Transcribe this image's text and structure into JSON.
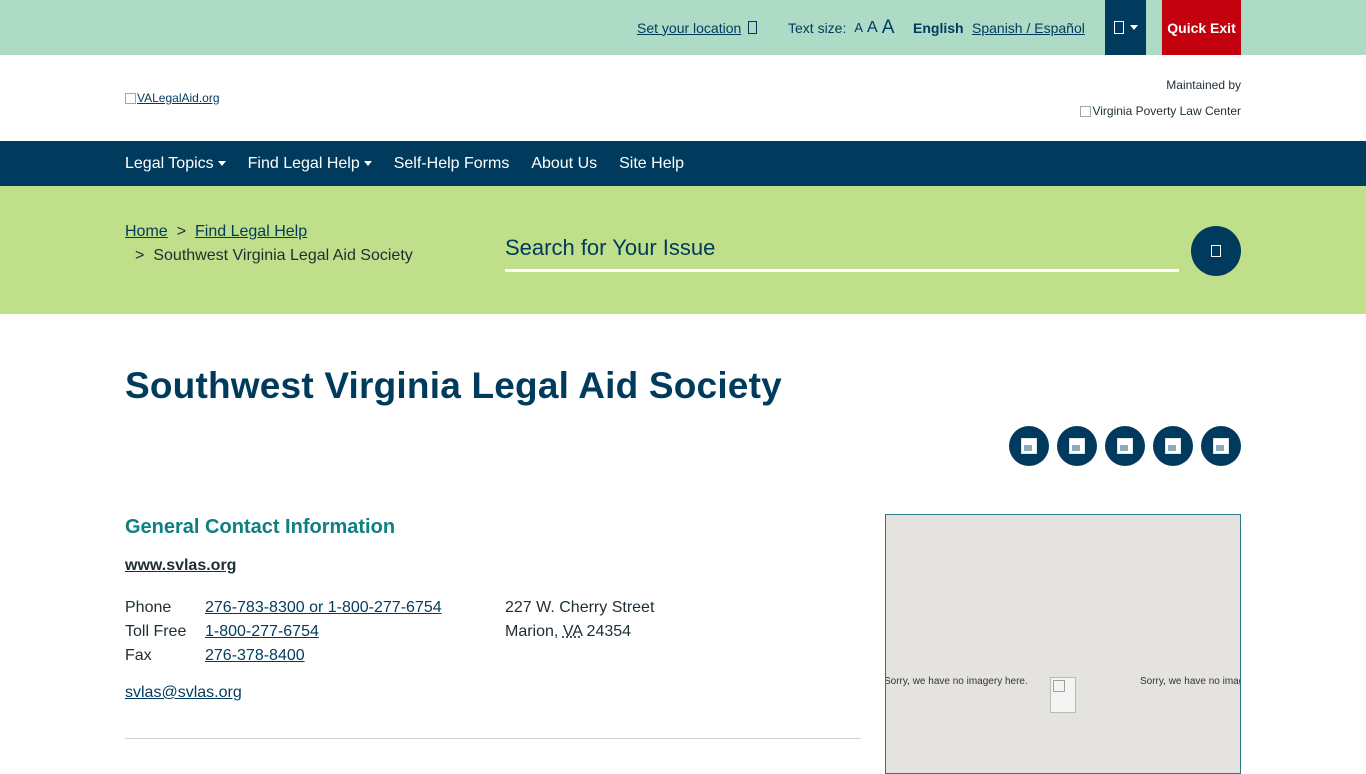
{
  "topbar": {
    "location_link": "Set your location",
    "text_size_label": "Text size:",
    "text_size_small": "A",
    "text_size_medium": "A",
    "text_size_large": "A",
    "lang_english": "English",
    "lang_spanish": "Spanish / Español",
    "quick_exit": "Quick Exit"
  },
  "header": {
    "logo_alt": "VALegalAid.org",
    "maintained_by": "Maintained by",
    "partner_alt": "Virginia Poverty Law Center"
  },
  "nav": {
    "items": [
      {
        "label": "Legal Topics"
      },
      {
        "label": "Find Legal Help"
      },
      {
        "label": "Self-Help Forms"
      },
      {
        "label": "About Us"
      },
      {
        "label": "Site Help"
      }
    ]
  },
  "breadcrumb": {
    "sep": ">",
    "home": "Home",
    "find_help": "Find Legal Help",
    "current": "Southwest Virginia Legal Aid Society"
  },
  "search": {
    "placeholder": "Search for Your Issue"
  },
  "page": {
    "title": "Southwest Virginia Legal Aid Society"
  },
  "share": {
    "icons": [
      "share-icon-1",
      "share-icon-2",
      "share-icon-3",
      "share-icon-4",
      "share-icon-5"
    ]
  },
  "contact": {
    "heading": "General Contact Information",
    "website": "www.svlas.org",
    "phone_label": "Phone",
    "phone_value": "276-783-8300 or 1-800-277-6754",
    "tollfree_label": "Toll Free",
    "tollfree_value": "1-800-277-6754",
    "fax_label": "Fax",
    "fax_value": "276-378-8400",
    "address_line1": "227 W. Cherry Street",
    "address_city": "Marion,",
    "address_state": "VA",
    "address_zip": "24354",
    "email": "svlas@svlas.org"
  },
  "map": {
    "no_imagery_1": "Sorry, we have no imagery here.",
    "no_imagery_2": "Sorry, we have no imagery here."
  },
  "colors": {
    "topbar": "#addbc6",
    "navy": "#003a5d",
    "band": "#c0df8a",
    "quick_exit": "#c3000d",
    "teal_heading": "#0e8080"
  }
}
